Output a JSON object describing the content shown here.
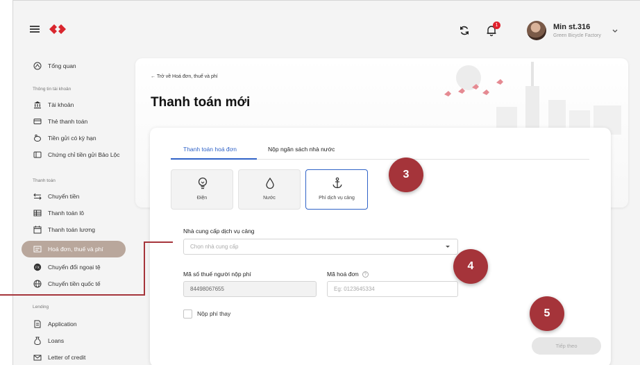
{
  "header": {
    "notification_count": "1",
    "user_name": "Min st.316",
    "user_company": "Green Bicycle Factory",
    "icons": [
      "menu-icon",
      "logo-icon",
      "refresh-icon",
      "bell-icon",
      "avatar",
      "chevron-down-icon"
    ]
  },
  "sidebar": {
    "overview": "Tổng quan",
    "section_account": "Thông tin tài khoản",
    "account": "Tài khoản",
    "card_payment": "Thẻ thanh toán",
    "term_deposit": "Tiền gửi có kỳ hạn",
    "certificate": "Chứng chỉ tiền gửi Bảo Lộc",
    "section_payment": "Thanh toán",
    "transfer": "Chuyển tiền",
    "batch_payment": "Thanh toán lô",
    "payroll": "Thanh toán lương",
    "bills_tax": "Hoá đơn, thuế và phí",
    "fx": "Chuyển đổi ngoại tệ",
    "intl_transfer": "Chuyển tiền quốc tế",
    "section_lending": "Lending",
    "application": "Application",
    "loans": "Loans",
    "letter_of_credit": "Letter of credit"
  },
  "page": {
    "back_link": "Trở về Hoá đơn, thuế và phí",
    "title": "Thanh toán mới"
  },
  "form": {
    "tabs": [
      "Thanh toán hoá đơn",
      "Nộp ngân sách nhà nước"
    ],
    "services": [
      "Điện",
      "Nước",
      "Phí dịch vụ cảng"
    ],
    "provider_label": "Nhà cung cấp dịch vụ cảng",
    "provider_placeholder": "Chọn nhà cung cấp",
    "tax_id_label": "Mã số thuế người nộp phí",
    "tax_id_value": "84498067655",
    "invoice_label": "Mã hoá đơn",
    "invoice_placeholder": "Eg: 0123645334",
    "pay_on_behalf": "Nộp phí thay",
    "next_button": "Tiếp theo"
  },
  "steps": [
    "3",
    "4",
    "5"
  ],
  "colors": {
    "accent": "#2f62c7",
    "brand_red": "#e0202c",
    "step_marker": "#a5343a",
    "active_sidebar": "#b9a79c"
  }
}
